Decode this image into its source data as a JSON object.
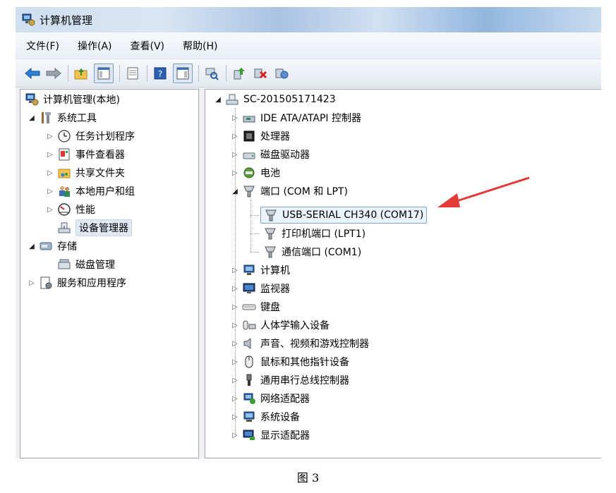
{
  "window": {
    "title": "计算机管理",
    "menu": [
      "文件(F)",
      "操作(A)",
      "查看(V)",
      "帮助(H)"
    ]
  },
  "left_tree": [
    {
      "label": "计算机管理(本地)",
      "icon": "computer-management-icon",
      "level": 0,
      "arrow": "none"
    },
    {
      "label": "系统工具",
      "icon": "tools-icon",
      "level": 1,
      "arrow": "open"
    },
    {
      "label": "任务计划程序",
      "icon": "clock-icon",
      "level": 2,
      "arrow": "closed"
    },
    {
      "label": "事件查看器",
      "icon": "event-viewer-icon",
      "level": 2,
      "arrow": "closed"
    },
    {
      "label": "共享文件夹",
      "icon": "shared-folder-icon",
      "level": 2,
      "arrow": "closed"
    },
    {
      "label": "本地用户和组",
      "icon": "users-icon",
      "level": 2,
      "arrow": "closed"
    },
    {
      "label": "性能",
      "icon": "performance-icon",
      "level": 2,
      "arrow": "closed"
    },
    {
      "label": "设备管理器",
      "icon": "device-manager-icon",
      "level": 2,
      "arrow": "none",
      "selected": true
    },
    {
      "label": "存储",
      "icon": "storage-icon",
      "level": 1,
      "arrow": "open"
    },
    {
      "label": "磁盘管理",
      "icon": "disk-management-icon",
      "level": 2,
      "arrow": "none"
    },
    {
      "label": "服务和应用程序",
      "icon": "services-icon",
      "level": 1,
      "arrow": "closed"
    }
  ],
  "device_tree": {
    "root": "SC-201505171423",
    "items": [
      {
        "label": "IDE ATA/ATAPI 控制器",
        "icon": "ide-controller-icon"
      },
      {
        "label": "处理器",
        "icon": "processor-icon"
      },
      {
        "label": "磁盘驱动器",
        "icon": "disk-drive-icon"
      },
      {
        "label": "电池",
        "icon": "battery-icon"
      },
      {
        "label": "端口 (COM 和 LPT)",
        "icon": "port-icon",
        "expanded": true,
        "children": [
          {
            "label": "USB-SERIAL CH340 (COM17)",
            "icon": "port-icon",
            "selected": true
          },
          {
            "label": "打印机端口 (LPT1)",
            "icon": "port-icon"
          },
          {
            "label": "通信端口 (COM1)",
            "icon": "port-icon"
          }
        ]
      },
      {
        "label": "计算机",
        "icon": "computer-icon"
      },
      {
        "label": "监视器",
        "icon": "monitor-icon"
      },
      {
        "label": "键盘",
        "icon": "keyboard-icon"
      },
      {
        "label": "人体学输入设备",
        "icon": "hid-icon"
      },
      {
        "label": "声音、视频和游戏控制器",
        "icon": "speaker-icon"
      },
      {
        "label": "鼠标和其他指针设备",
        "icon": "mouse-icon"
      },
      {
        "label": "通用串行总线控制器",
        "icon": "usb-icon"
      },
      {
        "label": "网络适配器",
        "icon": "network-icon"
      },
      {
        "label": "系统设备",
        "icon": "system-device-icon"
      },
      {
        "label": "显示适配器",
        "icon": "display-adapter-icon"
      }
    ]
  },
  "caption": "图 3",
  "colors": {
    "highlight_arrow": "#e23a36",
    "selection_border": "#7da2ce"
  }
}
